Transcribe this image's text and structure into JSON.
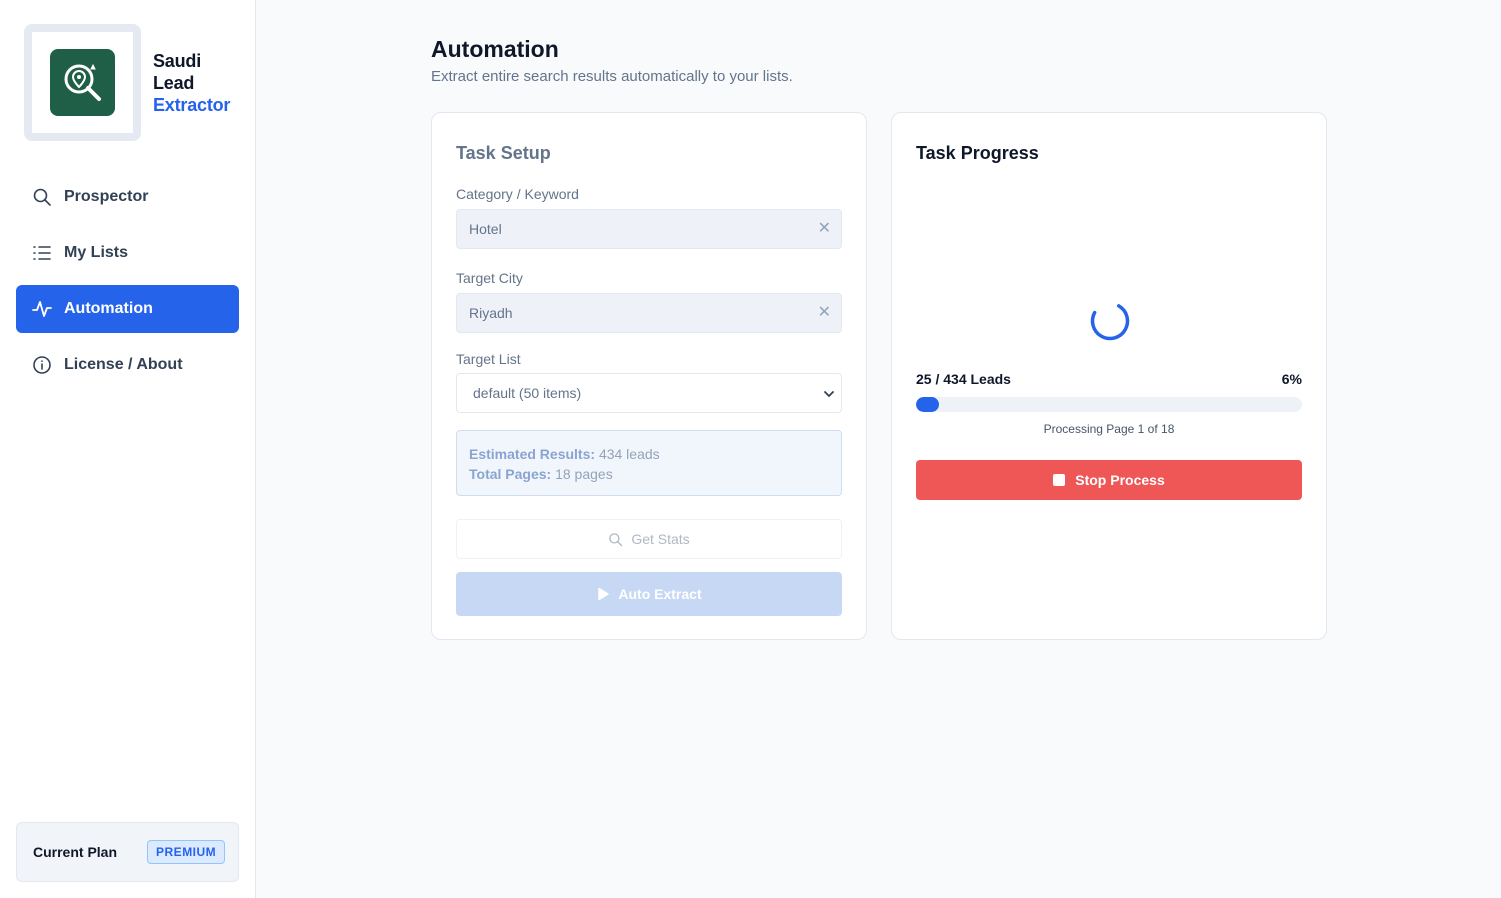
{
  "sidebar": {
    "brand": {
      "line1": "Saudi",
      "line2": "Lead",
      "line3": "Extractor"
    },
    "items": [
      {
        "label": "Prospector",
        "icon": "search-icon",
        "active": false
      },
      {
        "label": "My Lists",
        "icon": "list-icon",
        "active": false
      },
      {
        "label": "Automation",
        "icon": "activity-icon",
        "active": true
      },
      {
        "label": "License / About",
        "icon": "info-icon",
        "active": false
      }
    ],
    "plan": {
      "label": "Current Plan",
      "badge": "PREMIUM"
    }
  },
  "header": {
    "title": "Automation",
    "subtitle": "Extract entire search results automatically to your lists."
  },
  "setup": {
    "title": "Task Setup",
    "keyword_label": "Category / Keyword",
    "keyword_value": "Hotel",
    "city_label": "Target City",
    "city_value": "Riyadh",
    "list_label": "Target List",
    "list_value": "default (50 items)",
    "clear_glyph": "✕",
    "estimated_label": "Estimated Results:",
    "estimated_value": "434 leads",
    "pages_label": "Total Pages:",
    "pages_value": "18 pages",
    "stats_button": "Get Stats",
    "auto_button": "Auto Extract"
  },
  "progress": {
    "title": "Task Progress",
    "leads_text": "25 / 434 Leads",
    "percent_text": "6%",
    "percent_value": 0.06,
    "status": "Processing Page 1 of 18",
    "stop_button": "Stop Process"
  },
  "colors": {
    "accent": "#2563eb",
    "danger": "#ef5656",
    "logo_bg": "#1f5f47"
  }
}
